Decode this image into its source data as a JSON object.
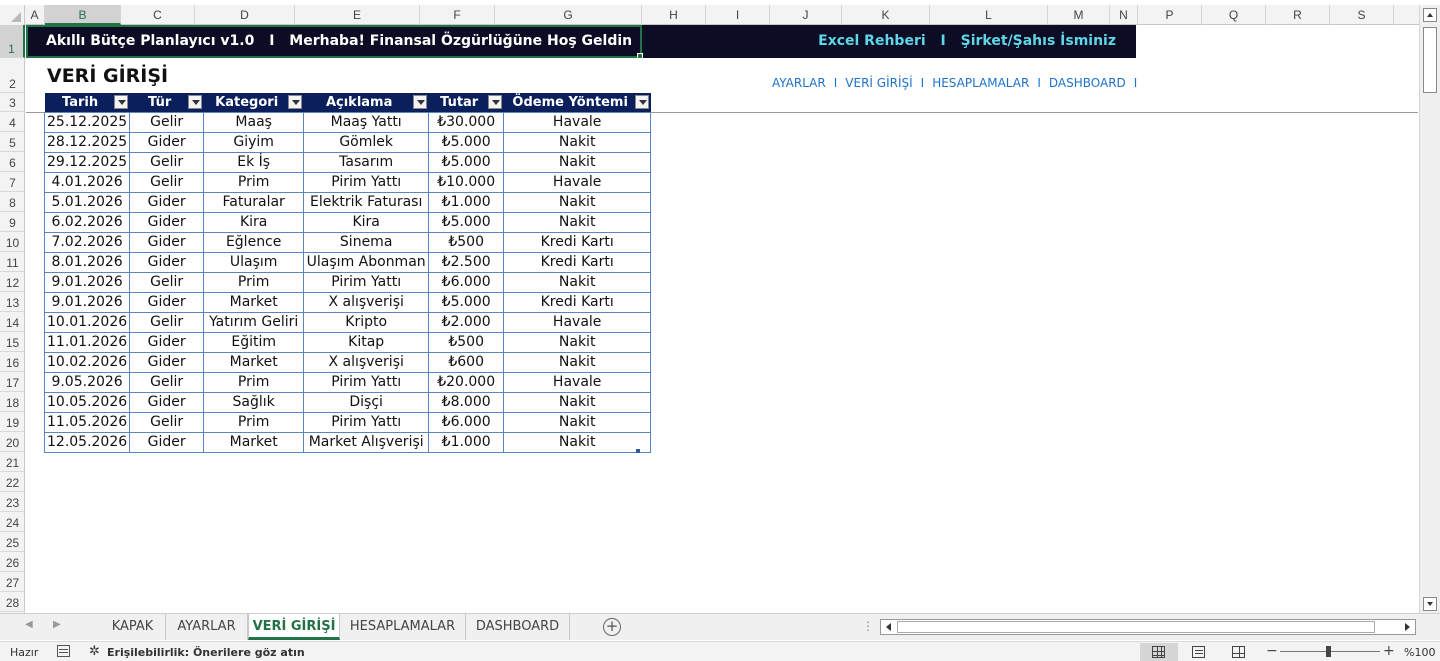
{
  "columns": [
    "A",
    "B",
    "C",
    "D",
    "E",
    "F",
    "G",
    "H",
    "I",
    "J",
    "K",
    "L",
    "M",
    "N",
    "P",
    "Q",
    "R",
    "S"
  ],
  "rows": [
    "1",
    "2",
    "3",
    "4",
    "5",
    "6",
    "7",
    "8",
    "9",
    "10",
    "11",
    "12",
    "13",
    "14",
    "15",
    "16",
    "17",
    "18",
    "19",
    "20",
    "21",
    "22",
    "23",
    "24",
    "25",
    "26",
    "27",
    "28"
  ],
  "banner": {
    "app_title": "Akıllı Bütçe Planlayıcı v1.0",
    "separator": "I",
    "greeting": "Merhaba! Finansal Özgürlüğüne Hoş Geldin",
    "brand": "Excel Rehberi",
    "company": "Şirket/Şahıs İsminiz"
  },
  "page_title": "VERİ GİRİŞİ",
  "nav": {
    "links": [
      "AYARLAR",
      "VERİ GİRİŞİ",
      "HESAPLAMALAR",
      "DASHBOARD"
    ],
    "separator": "I"
  },
  "table": {
    "headers": [
      "Tarih",
      "Tür",
      "Kategori",
      "Açıklama",
      "Tutar",
      "Ödeme Yöntemi"
    ],
    "rows": [
      [
        "25.12.2025",
        "Gelir",
        "Maaş",
        "Maaş Yattı",
        "₺30.000",
        "Havale"
      ],
      [
        "28.12.2025",
        "Gider",
        "Giyim",
        "Gömlek",
        "₺5.000",
        "Nakit"
      ],
      [
        "29.12.2025",
        "Gelir",
        "Ek İş",
        "Tasarım",
        "₺5.000",
        "Nakit"
      ],
      [
        "4.01.2026",
        "Gelir",
        "Prim",
        "Pirim Yattı",
        "₺10.000",
        "Havale"
      ],
      [
        "5.01.2026",
        "Gider",
        "Faturalar",
        "Elektrik Faturası",
        "₺1.000",
        "Nakit"
      ],
      [
        "6.02.2026",
        "Gider",
        "Kira",
        "Kira",
        "₺5.000",
        "Nakit"
      ],
      [
        "7.02.2026",
        "Gider",
        "Eğlence",
        "Sinema",
        "₺500",
        "Kredi Kartı"
      ],
      [
        "8.01.2026",
        "Gider",
        "Ulaşım",
        "Ulaşım Abonman",
        "₺2.500",
        "Kredi Kartı"
      ],
      [
        "9.01.2026",
        "Gelir",
        "Prim",
        "Pirim Yattı",
        "₺6.000",
        "Nakit"
      ],
      [
        "9.01.2026",
        "Gider",
        "Market",
        "X alışverişi",
        "₺5.000",
        "Kredi Kartı"
      ],
      [
        "10.01.2026",
        "Gelir",
        "Yatırım Geliri",
        "Kripto",
        "₺2.000",
        "Havale"
      ],
      [
        "11.01.2026",
        "Gider",
        "Eğitim",
        "Kitap",
        "₺500",
        "Nakit"
      ],
      [
        "10.02.2026",
        "Gider",
        "Market",
        "X alışverişi",
        "₺600",
        "Nakit"
      ],
      [
        "9.05.2026",
        "Gelir",
        "Prim",
        "Pirim Yattı",
        "₺20.000",
        "Havale"
      ],
      [
        "10.05.2026",
        "Gider",
        "Sağlık",
        "Dişçi",
        "₺8.000",
        "Nakit"
      ],
      [
        "11.05.2026",
        "Gelir",
        "Prim",
        "Pirim Yattı",
        "₺6.000",
        "Nakit"
      ],
      [
        "12.05.2026",
        "Gider",
        "Market",
        "Market Alışverişi",
        "₺1.000",
        "Nakit"
      ]
    ]
  },
  "sheet_tabs": [
    "KAPAK",
    "AYARLAR",
    "VERİ GİRİŞİ",
    "HESAPLAMALAR",
    "DASHBOARD"
  ],
  "active_sheet": "VERİ GİRİŞİ",
  "status": {
    "ready": "Hazır",
    "accessibility": "Erişilebilirlik: Önerilere göz atın",
    "zoom": "%100"
  },
  "colors": {
    "banner_bg": "#0c0c24",
    "banner_accent": "#5fd6e6",
    "table_header_bg": "#0a1f5c",
    "nav_link": "#1e73c8",
    "selection": "#217346"
  }
}
